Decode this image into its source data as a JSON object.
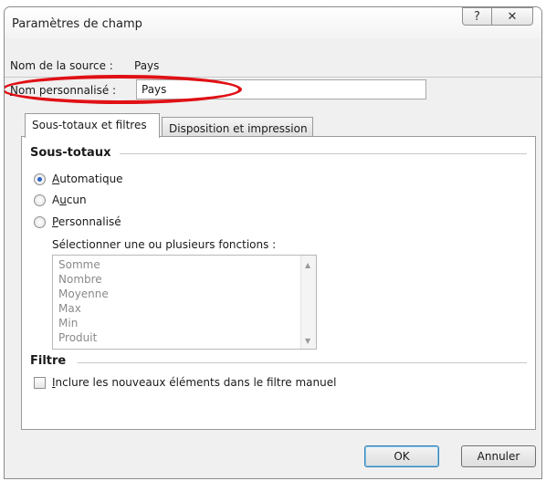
{
  "window": {
    "title": "Paramètres de champ",
    "help_glyph": "?",
    "close_glyph": "✕"
  },
  "source": {
    "label": "Nom de la source :",
    "value": "Pays"
  },
  "custom_name": {
    "label_mnemonic": "N",
    "label_rest": "om personnalisé :",
    "value": "Pays"
  },
  "tabs": [
    {
      "label": "Sous-totaux et filtres",
      "active": true
    },
    {
      "label": "Disposition et impression",
      "active": false
    }
  ],
  "subtotals": {
    "heading": "Sous-totaux",
    "options": [
      {
        "mnemonic": "A",
        "rest": "utomatique",
        "checked": true
      },
      {
        "pre": "A",
        "mnemonic": "u",
        "rest": "cun",
        "checked": false
      },
      {
        "mnemonic": "P",
        "rest": "ersonnalisé",
        "checked": false
      }
    ],
    "functions_label": "Sélectionner une ou plusieurs fonctions :",
    "functions": [
      "Somme",
      "Nombre",
      "Moyenne",
      "Max",
      "Min",
      "Produit"
    ]
  },
  "filter": {
    "heading": "Filtre",
    "include_mnemonic": "I",
    "include_rest": "nclure les nouveaux éléments dans le filtre manuel",
    "include_checked": false
  },
  "buttons": {
    "ok": "OK",
    "cancel": "Annuler"
  },
  "colors": {
    "highlight_oval": "#e01015",
    "radio_dot": "#2b64c5"
  }
}
